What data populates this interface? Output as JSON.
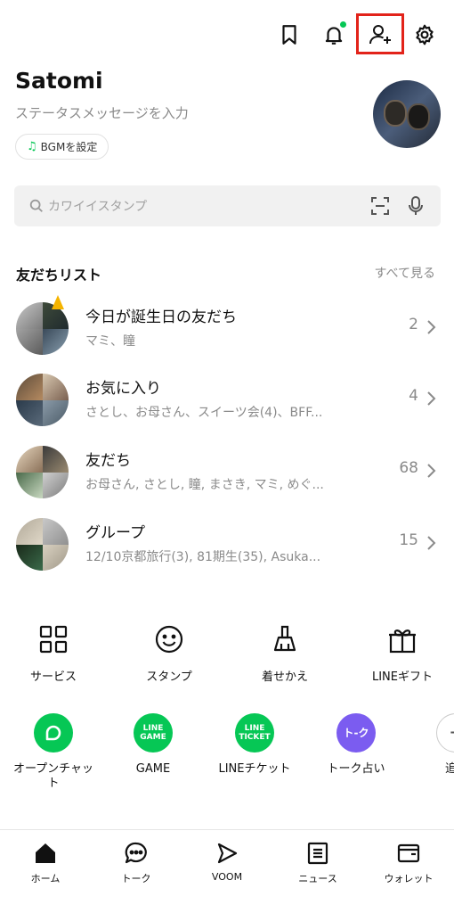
{
  "profile": {
    "name": "Satomi",
    "status_placeholder": "ステータスメッセージを入力",
    "bgm_label": "BGMを設定"
  },
  "search": {
    "placeholder": "カワイイスタンプ"
  },
  "friends_section": {
    "title": "友だちリスト",
    "see_all": "すべて見る",
    "rows": [
      {
        "title": "今日が誕生日の友だち",
        "subtitle": "マミ、瞳",
        "count": "2"
      },
      {
        "title": "お気に入り",
        "subtitle": "さとし、お母さん、スイーツ会(4)、BFF...",
        "count": "4"
      },
      {
        "title": "友だち",
        "subtitle": "お母さん, さとし, 瞳, まさき, マミ, めぐ...",
        "count": "68"
      },
      {
        "title": "グループ",
        "subtitle": "12/10京都旅行(3), 81期生(35), Asuka...",
        "count": "15"
      }
    ]
  },
  "services": [
    {
      "label": "サービス",
      "icon": "grid-icon"
    },
    {
      "label": "スタンプ",
      "icon": "smile-icon"
    },
    {
      "label": "着せかえ",
      "icon": "brush-icon"
    },
    {
      "label": "LINEギフト",
      "icon": "gift-icon"
    }
  ],
  "apps": [
    {
      "label": "オープンチャット",
      "icon_text": "",
      "color": "#06c755"
    },
    {
      "label": "GAME",
      "icon_text": "LINE GAME",
      "color": "#06c755"
    },
    {
      "label": "LINEチケット",
      "icon_text": "LINE TICKET",
      "color": "#06c755"
    },
    {
      "label": "トーク占い",
      "icon_text": "ト-ク",
      "color": "#7b5cf0"
    },
    {
      "label": "追",
      "icon_text": "",
      "color": "#ffffff"
    }
  ],
  "bottom_nav": [
    {
      "label": "ホーム",
      "icon": "home-icon"
    },
    {
      "label": "トーク",
      "icon": "chat-icon"
    },
    {
      "label": "VOOM",
      "icon": "voom-icon"
    },
    {
      "label": "ニュース",
      "icon": "news-icon"
    },
    {
      "label": "ウォレット",
      "icon": "wallet-icon"
    }
  ],
  "colors": {
    "accent": "#06c755",
    "highlight": "#e2231a"
  }
}
